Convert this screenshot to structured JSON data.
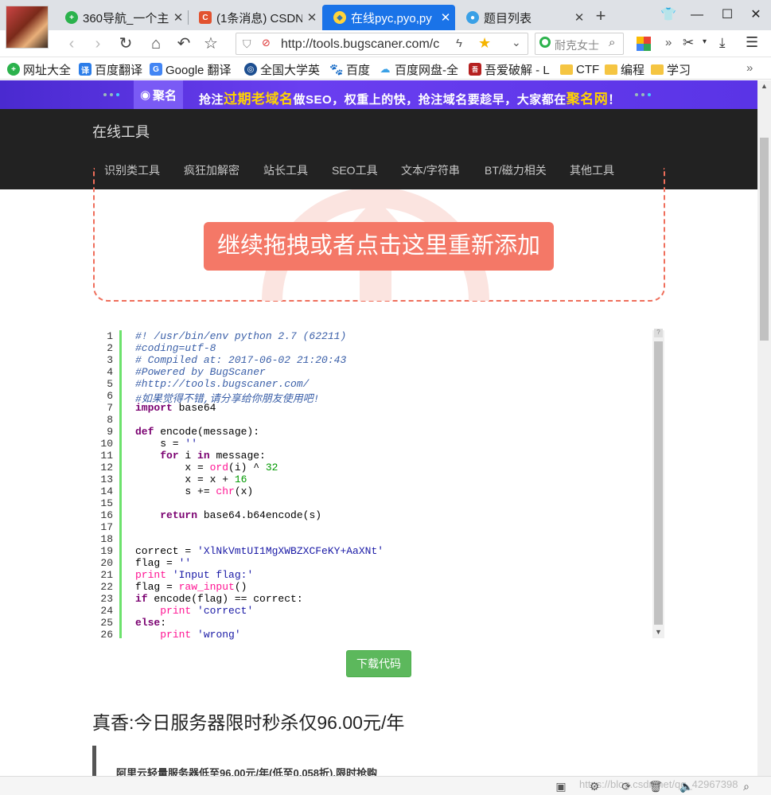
{
  "tabs": [
    {
      "label": "360导航_一个主",
      "icon": "360-nav-icon",
      "active": false
    },
    {
      "label": "(1条消息) CSDN",
      "icon": "csdn-icon",
      "active": false
    },
    {
      "label": "在线pyc,pyo,py",
      "icon": "python-icon",
      "active": true
    },
    {
      "label": "题目列表",
      "icon": "ctf-icon",
      "active": false
    }
  ],
  "address_bar": {
    "url": "http://tools.bugscaner.com/c"
  },
  "search_box": {
    "placeholder": "耐克女士"
  },
  "bookmarks": [
    {
      "label": "网址大全",
      "icon": "360-nav-icon"
    },
    {
      "label": "百度翻译",
      "icon": "translate-icon"
    },
    {
      "label": "Google 翻译",
      "icon": "google-translate-icon"
    },
    {
      "label": "全国大学英",
      "icon": "university-icon"
    },
    {
      "label": "百度",
      "icon": "baidu-icon"
    },
    {
      "label": "百度网盘-全",
      "icon": "baidu-pan-icon"
    },
    {
      "label": "吾爱破解 - L",
      "icon": "52pojie-icon"
    },
    {
      "label": "CTF",
      "icon": "folder-icon"
    },
    {
      "label": "编程",
      "icon": "folder-icon"
    },
    {
      "label": "学习",
      "icon": "folder-icon"
    }
  ],
  "banner": {
    "logo": "聚名",
    "text_a": "抢注",
    "text_hl1": "过期老域名",
    "text_b": "做SEO，权重上的快，抢注域名要趁早，大家都在",
    "text_hl2": "聚名网",
    "text_c": "！"
  },
  "site": {
    "title": "在线工具",
    "nav": [
      "识别类工具",
      "疯狂加解密",
      "站长工具",
      "SEO工具",
      "文本/字符串",
      "BT/磁力相关",
      "其他工具"
    ]
  },
  "dropzone": {
    "button_label": "继续拖拽或者点击这里重新添加"
  },
  "code_lines": [
    [
      [
        "cm",
        "#! /usr/bin/env python 2.7 (62211)"
      ]
    ],
    [
      [
        "cm",
        "#coding=utf-8"
      ]
    ],
    [
      [
        "cm",
        "# Compiled at: 2017-06-02 21:20:43"
      ]
    ],
    [
      [
        "cm",
        "#Powered by BugScaner"
      ]
    ],
    [
      [
        "cm",
        "#http://tools.bugscaner.com/"
      ]
    ],
    [
      [
        "cm",
        "#如果觉得不错,请分享给你朋友使用吧!"
      ]
    ],
    [
      [
        "kw",
        "import"
      ],
      [
        "",
        " base64"
      ]
    ],
    [],
    [
      [
        "kw",
        "def"
      ],
      [
        "",
        " encode(message):"
      ]
    ],
    [
      [
        "",
        "    s = "
      ],
      [
        "st",
        "''"
      ]
    ],
    [
      [
        "",
        "    "
      ],
      [
        "kw",
        "for"
      ],
      [
        "",
        " i "
      ],
      [
        "kw",
        "in"
      ],
      [
        "",
        " message:"
      ]
    ],
    [
      [
        "",
        "        x = "
      ],
      [
        "fn",
        "ord"
      ],
      [
        "",
        "(i) ^ "
      ],
      [
        "nm",
        "32"
      ]
    ],
    [
      [
        "",
        "        x = x + "
      ],
      [
        "nm",
        "16"
      ]
    ],
    [
      [
        "",
        "        s += "
      ],
      [
        "fn",
        "chr"
      ],
      [
        "",
        "(x)"
      ]
    ],
    [],
    [
      [
        "",
        "    "
      ],
      [
        "kw",
        "return"
      ],
      [
        "",
        " base64.b64encode(s)"
      ]
    ],
    [],
    [],
    [
      [
        "",
        "correct = "
      ],
      [
        "st",
        "'XlNkVmtUI1MgXWBZXCFeKY+AaXNt'"
      ]
    ],
    [
      [
        "",
        "flag = "
      ],
      [
        "st",
        "''"
      ]
    ],
    [
      [
        "fn",
        "print"
      ],
      [
        "",
        " "
      ],
      [
        "st",
        "'Input flag:'"
      ]
    ],
    [
      [
        "",
        "flag = "
      ],
      [
        "fn",
        "raw_input"
      ],
      [
        "",
        "()"
      ]
    ],
    [
      [
        "kw",
        "if"
      ],
      [
        "",
        " encode(flag) == correct:"
      ]
    ],
    [
      [
        "",
        "    "
      ],
      [
        "fn",
        "print"
      ],
      [
        "",
        " "
      ],
      [
        "st",
        "'correct'"
      ]
    ],
    [
      [
        "kw",
        "else"
      ],
      [
        "",
        ":"
      ]
    ],
    [
      [
        "",
        "    "
      ],
      [
        "fn",
        "print"
      ],
      [
        "",
        " "
      ],
      [
        "st",
        "'wrong'"
      ]
    ]
  ],
  "download_button": "下载代码",
  "promo": {
    "title": "真香:今日服务器限时秒杀仅96.00元/年",
    "quote": "阿里云轻量服务器低至96.00元/年(低至0.058折),限时抢购"
  },
  "watermark": "https://blog.csdn.net/qq_42967398",
  "colors": {
    "accent": "#1a73e8",
    "dropzone_border": "#ef6e5b",
    "dropzone_button": "#f47867",
    "download_button": "#5cb85c",
    "nav_bg": "#222222",
    "banner_bg": "#5a34e6",
    "banner_highlight": "#ffd400"
  }
}
